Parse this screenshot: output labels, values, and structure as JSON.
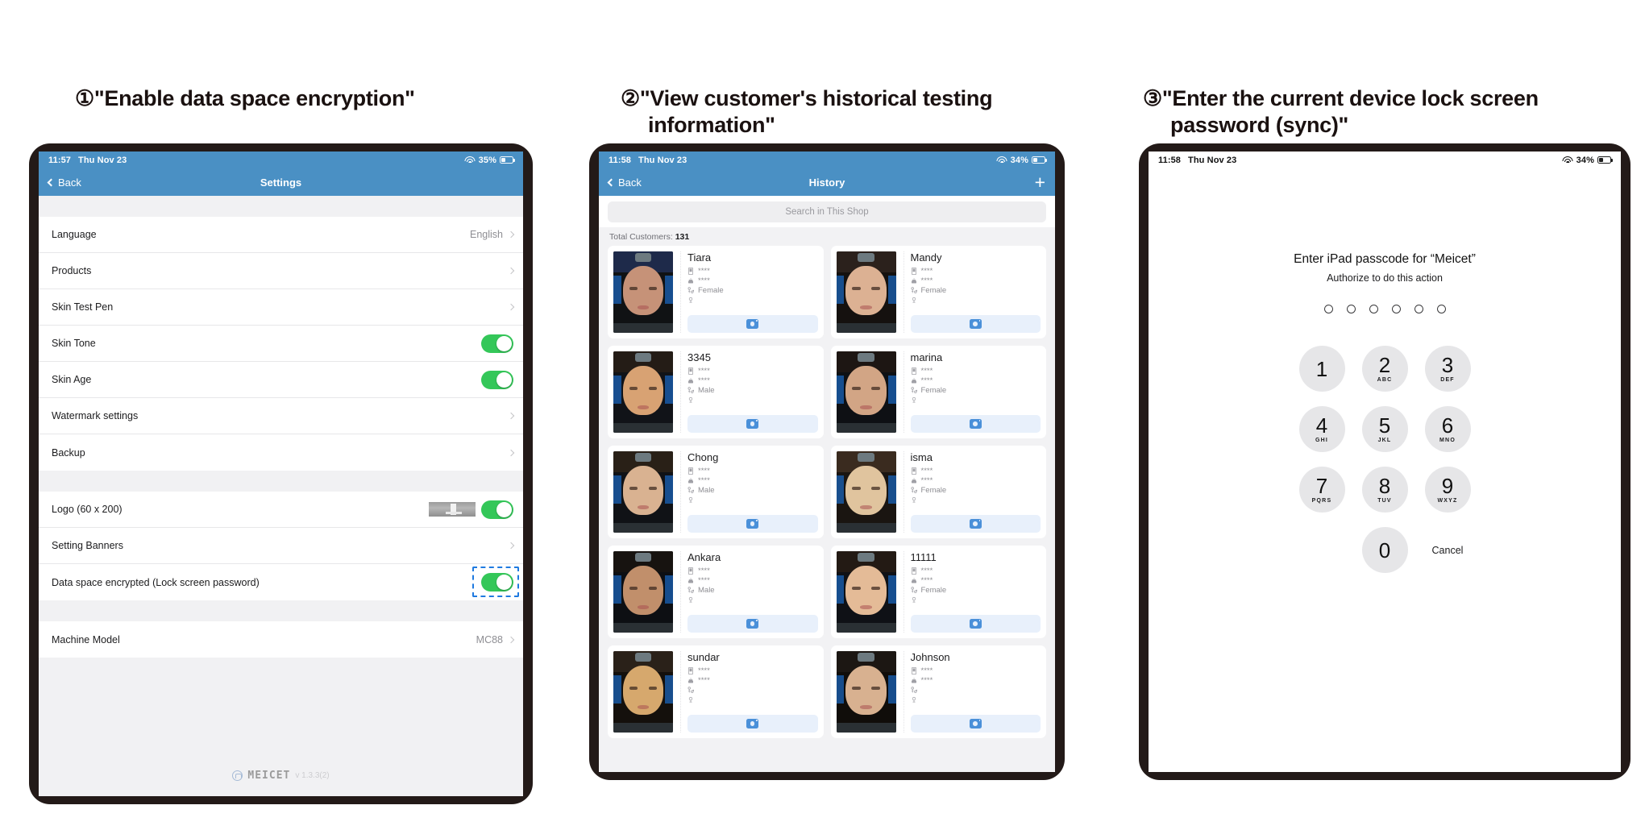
{
  "captions": [
    {
      "num": "①",
      "text": "\"Enable data space encryption\"",
      "cont": ""
    },
    {
      "num": "②",
      "text": "\"View customer's historical testing",
      "cont": "information\""
    },
    {
      "num": "③",
      "text": "\"Enter the current device lock screen",
      "cont": "password (sync)\""
    }
  ],
  "panel1": {
    "status": {
      "time": "11:57",
      "date": "Thu Nov 23",
      "battery": "35%",
      "wifi_icon": "wifi-icon",
      "battery_icon": "battery-icon"
    },
    "nav": {
      "back": "Back",
      "title": "Settings"
    },
    "group1": [
      {
        "label": "Language",
        "value": "English",
        "control": "chevron"
      },
      {
        "label": "Products",
        "value": "",
        "control": "chevron"
      },
      {
        "label": "Skin Test Pen",
        "value": "",
        "control": "chevron"
      },
      {
        "label": "Skin Tone",
        "value": "",
        "control": "toggle-on"
      },
      {
        "label": "Skin Age",
        "value": "",
        "control": "toggle-on"
      },
      {
        "label": "Watermark settings",
        "value": "",
        "control": "chevron"
      },
      {
        "label": "Backup",
        "value": "",
        "control": "chevron"
      }
    ],
    "group2": [
      {
        "label": "Logo (60 x 200)",
        "value": "",
        "control": "thumb-toggle-on"
      },
      {
        "label": "Setting Banners",
        "value": "",
        "control": "chevron"
      },
      {
        "label": "Data space encrypted  (Lock screen password)",
        "value": "",
        "control": "toggle-on-highlighted"
      }
    ],
    "group3": [
      {
        "label": "Machine Model",
        "value": "MC88",
        "control": "chevron"
      }
    ],
    "footer": {
      "brand": "MEICET",
      "version": "v 1.3.3(2)"
    },
    "highlight_color": "#1f7ae0"
  },
  "panel2": {
    "status": {
      "time": "11:58",
      "date": "Thu Nov 23",
      "battery": "34%"
    },
    "nav": {
      "back": "Back",
      "title": "History",
      "add": "+"
    },
    "search_placeholder": "Search in This Shop",
    "total_label": "Total Customers:",
    "total_value": "131",
    "shoot_icon": "camera-icon",
    "customers": [
      {
        "name": "Tiara",
        "phone": "****",
        "birthday": "****",
        "gender": "Female",
        "location": "",
        "skin": "#c69278",
        "hair": "#1e2a4a",
        "bg": "#101214"
      },
      {
        "name": "Mandy",
        "phone": "****",
        "birthday": "****",
        "gender": "Female",
        "location": "",
        "skin": "#dcb193",
        "hair": "#2b211c",
        "bg": "#15110f"
      },
      {
        "name": "3345",
        "phone": "****",
        "birthday": "****",
        "gender": "Male",
        "location": "",
        "skin": "#d8a273",
        "hair": "#241c16",
        "bg": "#111318"
      },
      {
        "name": "marina",
        "phone": "****",
        "birthday": "****",
        "gender": "Female",
        "location": "",
        "skin": "#d2a585",
        "hair": "#1d1613",
        "bg": "#0e1014"
      },
      {
        "name": "Chong",
        "phone": "****",
        "birthday": "****",
        "gender": "Male",
        "location": "",
        "skin": "#d9b291",
        "hair": "#292017",
        "bg": "#101216"
      },
      {
        "name": "isma",
        "phone": "****",
        "birthday": "****",
        "gender": "Female",
        "location": "",
        "skin": "#e0c49e",
        "hair": "#3a2b1f",
        "bg": "#1a1511"
      },
      {
        "name": "Ankara",
        "phone": "****",
        "birthday": "****",
        "gender": "Male",
        "location": "",
        "skin": "#c18f6b",
        "hair": "#171310",
        "bg": "#0d0f13"
      },
      {
        "name": "11111",
        "phone": "****",
        "birthday": "****",
        "gender": "Female",
        "location": "",
        "skin": "#e4bb97",
        "hair": "#231a14",
        "bg": "#0f1116"
      },
      {
        "name": "sundar",
        "phone": "****",
        "birthday": "****",
        "gender": "",
        "location": "",
        "skin": "#d6a86d",
        "hair": "#2a2119",
        "bg": "#14100c"
      },
      {
        "name": "Johnson",
        "phone": "****",
        "birthday": "****",
        "gender": "",
        "location": "",
        "skin": "#d8b190",
        "hair": "#1c1713",
        "bg": "#100d0a"
      }
    ]
  },
  "panel3": {
    "status": {
      "time": "11:58",
      "date": "Thu Nov 23",
      "battery": "34%"
    },
    "title": "Enter iPad passcode for “Meicet”",
    "subtitle": "Authorize to do this action",
    "dots_count": 6,
    "keys": [
      {
        "num": "1",
        "sub": ""
      },
      {
        "num": "2",
        "sub": "ABC"
      },
      {
        "num": "3",
        "sub": "DEF"
      },
      {
        "num": "4",
        "sub": "GHI"
      },
      {
        "num": "5",
        "sub": "JKL"
      },
      {
        "num": "6",
        "sub": "MNO"
      },
      {
        "num": "7",
        "sub": "PQRS"
      },
      {
        "num": "8",
        "sub": "TUV"
      },
      {
        "num": "9",
        "sub": "WXYZ"
      },
      {
        "num": "0",
        "sub": ""
      }
    ],
    "cancel": "Cancel"
  }
}
